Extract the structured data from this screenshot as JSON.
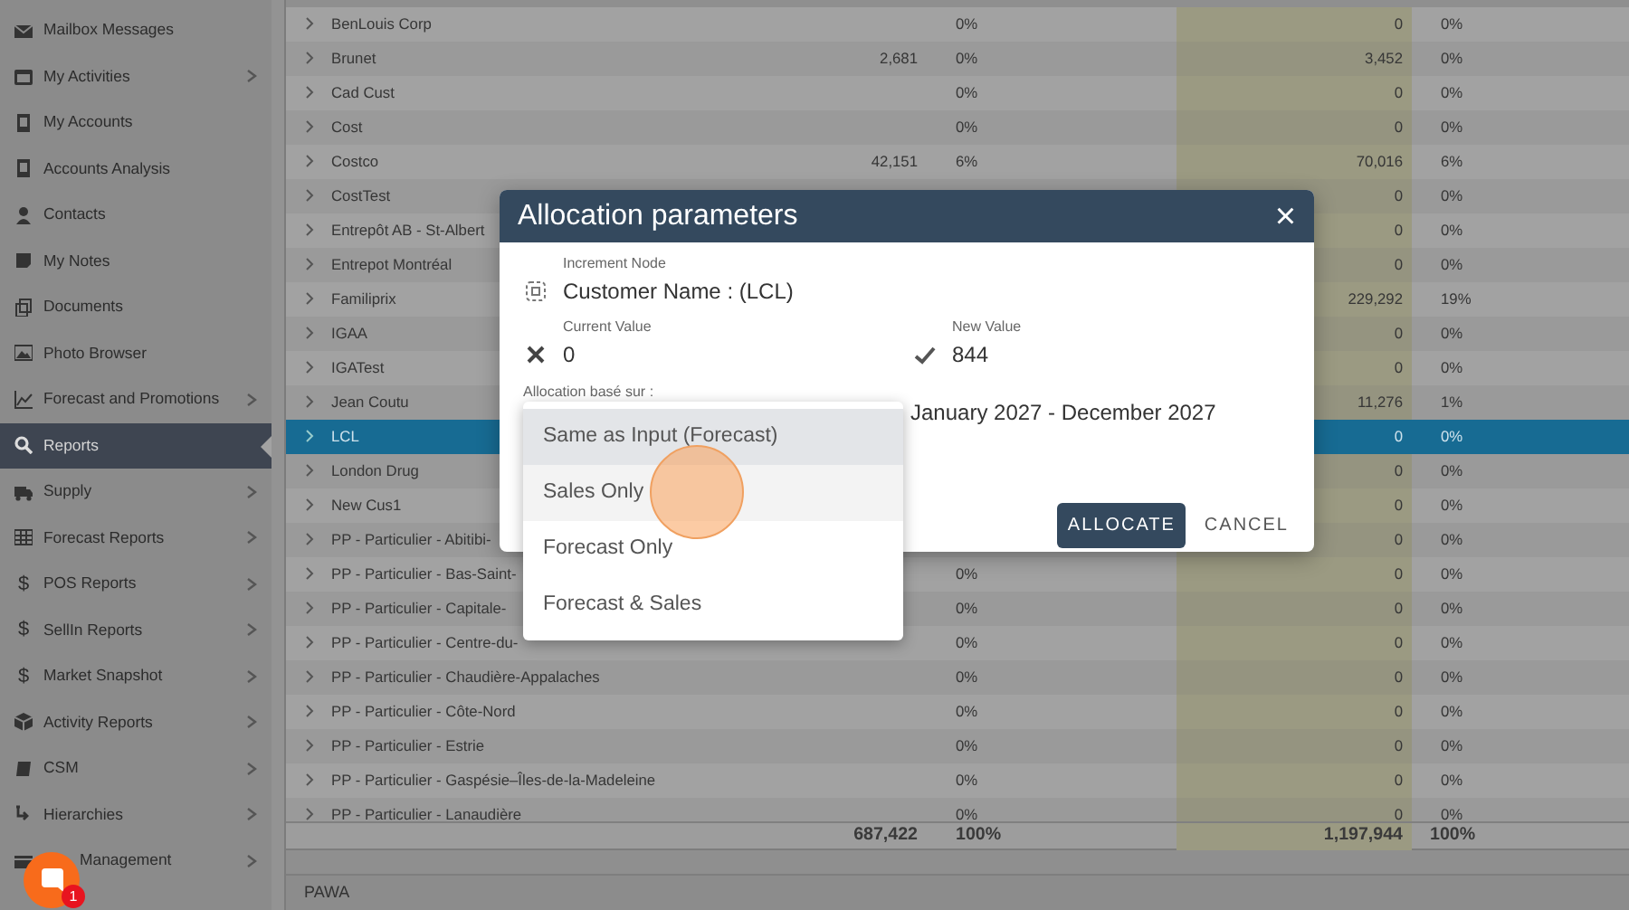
{
  "sidebar": {
    "items": [
      {
        "label": "Mailbox Messages",
        "has_submenu": false,
        "selected": false
      },
      {
        "label": "My Activities",
        "has_submenu": true,
        "selected": false
      },
      {
        "label": "My Accounts",
        "has_submenu": false,
        "selected": false
      },
      {
        "label": "Accounts Analysis",
        "has_submenu": false,
        "selected": false
      },
      {
        "label": "Contacts",
        "has_submenu": false,
        "selected": false
      },
      {
        "label": "My Notes",
        "has_submenu": false,
        "selected": false
      },
      {
        "label": "Documents",
        "has_submenu": false,
        "selected": false
      },
      {
        "label": "Photo Browser",
        "has_submenu": false,
        "selected": false
      },
      {
        "label": "Forecast and Promotions",
        "has_submenu": true,
        "selected": false
      },
      {
        "label": "Reports",
        "has_submenu": false,
        "selected": true
      },
      {
        "label": "Supply",
        "has_submenu": true,
        "selected": false
      },
      {
        "label": "Forecast Reports",
        "has_submenu": true,
        "selected": false
      },
      {
        "label": "POS Reports",
        "has_submenu": true,
        "selected": false,
        "icon_text": "$"
      },
      {
        "label": "SellIn Reports",
        "has_submenu": true,
        "selected": false,
        "icon_text": "$"
      },
      {
        "label": "Market Snapshot",
        "has_submenu": true,
        "selected": false,
        "icon_text": "$"
      },
      {
        "label": "Activity Reports",
        "has_submenu": true,
        "selected": false
      },
      {
        "label": "CSM",
        "has_submenu": true,
        "selected": false
      },
      {
        "label": "Hierarchies",
        "has_submenu": true,
        "selected": false
      },
      {
        "label": "Management",
        "has_submenu": true,
        "selected": false
      }
    ]
  },
  "table": {
    "rows": [
      {
        "name": "BenLouis Corp",
        "share": "0%",
        "forecast": "0",
        "forecast_share": "0%",
        "selected": false
      },
      {
        "name": "Brunet",
        "value": "2,681",
        "share": "0%",
        "forecast": "3,452",
        "forecast_share": "0%",
        "selected": false
      },
      {
        "name": "Cad Cust",
        "share": "0%",
        "forecast": "0",
        "forecast_share": "0%",
        "selected": false
      },
      {
        "name": "Cost",
        "share": "0%",
        "forecast": "0",
        "forecast_share": "0%",
        "selected": false
      },
      {
        "name": "Costco",
        "value": "42,151",
        "share": "6%",
        "forecast": "70,016",
        "forecast_share": "6%",
        "selected": false
      },
      {
        "name": "CostTest",
        "forecast": "0",
        "forecast_share": "0%",
        "selected": false
      },
      {
        "name": "Entrepôt AB - St-Albert",
        "forecast": "0",
        "forecast_share": "0%",
        "selected": false
      },
      {
        "name": "Entrepot Montréal",
        "forecast": "0",
        "forecast_share": "0%",
        "selected": false
      },
      {
        "name": "Familiprix",
        "forecast": "229,292",
        "forecast_share": "19%",
        "selected": false
      },
      {
        "name": "IGAA",
        "forecast": "0",
        "forecast_share": "0%",
        "selected": false
      },
      {
        "name": "IGATest",
        "forecast": "0",
        "forecast_share": "0%",
        "selected": false
      },
      {
        "name": "Jean Coutu",
        "forecast": "11,276",
        "forecast_share": "1%",
        "selected": false
      },
      {
        "name": "LCL",
        "forecast": "0",
        "forecast_share": "0%",
        "selected": true
      },
      {
        "name": "London Drug",
        "forecast": "0",
        "forecast_share": "0%",
        "selected": false
      },
      {
        "name": "New Cus1",
        "forecast": "0",
        "forecast_share": "0%",
        "selected": false
      },
      {
        "name": "PP - Particulier - Abitibi-",
        "forecast": "0",
        "forecast_share": "0%",
        "selected": false
      },
      {
        "name": "PP - Particulier - Bas-Saint-",
        "share": "0%",
        "forecast": "0",
        "forecast_share": "0%",
        "selected": false
      },
      {
        "name": "PP - Particulier - Capitale-",
        "share": "0%",
        "forecast": "0",
        "forecast_share": "0%",
        "selected": false
      },
      {
        "name": "PP - Particulier - Centre-du-",
        "share": "0%",
        "forecast": "0",
        "forecast_share": "0%",
        "selected": false
      },
      {
        "name": "PP - Particulier - Chaudière-Appalaches",
        "share": "0%",
        "forecast": "0",
        "forecast_share": "0%",
        "selected": false
      },
      {
        "name": "PP - Particulier - Côte-Nord",
        "share": "0%",
        "forecast": "0",
        "forecast_share": "0%",
        "selected": false
      },
      {
        "name": "PP - Particulier - Estrie",
        "share": "0%",
        "forecast": "0",
        "forecast_share": "0%",
        "selected": false
      },
      {
        "name": "PP - Particulier - Gaspésie–Îles-de-la-Madeleine",
        "share": "0%",
        "forecast": "0",
        "forecast_share": "0%",
        "selected": false
      },
      {
        "name": "PP - Particulier - Lanaudière",
        "share": "0%",
        "forecast": "0",
        "forecast_share": "0%",
        "selected": false
      }
    ],
    "totals": {
      "value": "687,422",
      "share": "100%",
      "forecast": "1,197,944",
      "forecast_share": "100%"
    }
  },
  "status_bar": {
    "text": "PAWA"
  },
  "dialog": {
    "title": "Allocation parameters",
    "close": "×",
    "increment_node": {
      "label": "Increment Node",
      "value": "Customer Name : (LCL)"
    },
    "current_value": {
      "label": "Current Value",
      "value": "0"
    },
    "new_value": {
      "label": "New Value",
      "value": "844"
    },
    "based_on": {
      "label": "Allocation basé sur :",
      "options": [
        {
          "label": "Same as Input (Forecast)",
          "selected": true,
          "hovered": false
        },
        {
          "label": "Sales Only",
          "selected": false,
          "hovered": true
        },
        {
          "label": "Forecast Only",
          "selected": false,
          "hovered": false
        },
        {
          "label": "Forecast & Sales",
          "selected": false,
          "hovered": false
        }
      ]
    },
    "period": "January 2027 - December 2027",
    "buttons": [
      {
        "label": "ALLOCATE",
        "kind": "primary"
      },
      {
        "label": "CANCEL",
        "kind": "text"
      }
    ]
  },
  "chat": {
    "badge": "1"
  }
}
